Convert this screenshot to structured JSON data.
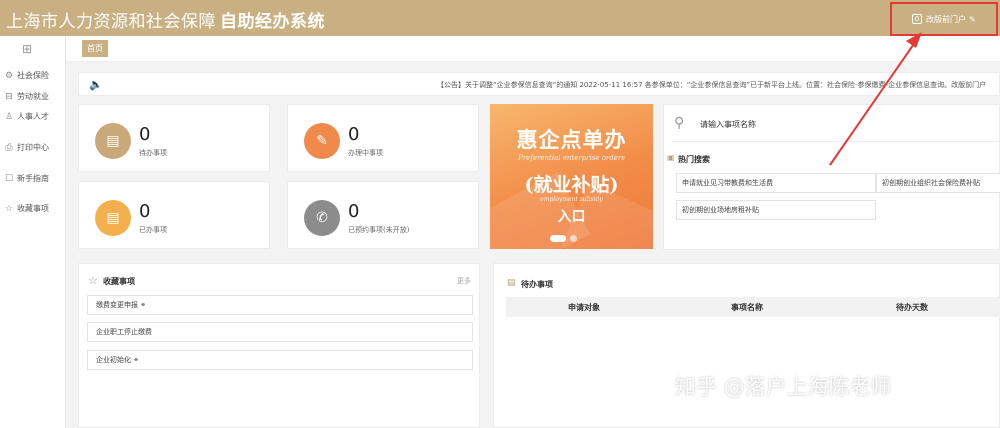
{
  "header": {
    "title_main": "上海市人力资源和社会保障",
    "title_bold": "自助经办系统",
    "portal_badge": "0",
    "portal_label": "改版前门户"
  },
  "sidebar": {
    "items": [
      {
        "label": "社会保险",
        "icon": "gear-icon"
      },
      {
        "label": "劳动就业",
        "icon": "briefcase-icon"
      },
      {
        "label": "人事人才",
        "icon": "person-icon"
      },
      {
        "label": "打印中心",
        "icon": "printer-icon"
      },
      {
        "label": "新手指南",
        "icon": "guide-icon"
      },
      {
        "label": "收藏事项",
        "icon": "star-icon"
      }
    ]
  },
  "tabs": {
    "home": "首页"
  },
  "notice": {
    "text": "【公告】关于调整“企业参保信息查询”的通知 2022-05-11 16:57 各参保单位：“企业参保信息查询”已于新平台上线。位置：社会保险-参保缴费-企业参保信息查询。改版前门户"
  },
  "stats": [
    {
      "value": "0",
      "label": "待办事项",
      "color": "#c9a97a"
    },
    {
      "value": "0",
      "label": "办理中事项",
      "color": "#f08a4b"
    },
    {
      "value": "0",
      "label": "已办事项",
      "color": "#f5b04e"
    },
    {
      "value": "0",
      "label": "已预约事项(未开放)",
      "color": "#8c8c8c"
    }
  ],
  "banner": {
    "title": "惠企点单办",
    "en1": "Preferential enterprise orders",
    "subtitle": "(就业补贴)",
    "en2": "employment subsidy",
    "entry": "入口"
  },
  "search": {
    "placeholder": "请输入事项名称",
    "hot_title": "热门搜索",
    "hot_items": [
      "申请就业见习带教费和生活费",
      "初创期创业组织社会保险费补贴",
      "初创期创业场地房租补贴"
    ]
  },
  "favorites": {
    "title": "收藏事项",
    "more": "更多",
    "items": [
      "缴费变更申报",
      "企业职工停止缴费",
      "企业初始化"
    ]
  },
  "todo": {
    "title": "待办事项",
    "columns": [
      "申请对象",
      "事项名称",
      "待办天数"
    ]
  },
  "watermark": "知乎 @落户上海陈老师"
}
